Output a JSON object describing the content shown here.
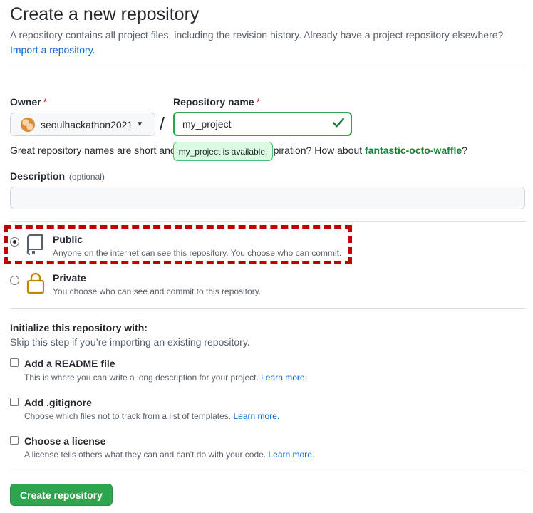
{
  "page": {
    "title": "Create a new repository",
    "intro": "A repository contains all project files, including the revision history. Already have a project repository elsewhere?",
    "import_link": "Import a repository."
  },
  "owner": {
    "label": "Owner",
    "required_mark": "*",
    "value": "seoulhackathon2021"
  },
  "repo_name": {
    "label": "Repository name",
    "required_mark": "*",
    "value": "my_project",
    "availability_tooltip": "my_project is available.",
    "valid_icon": "check-icon"
  },
  "name_hint": {
    "prefix": "Great repository names are short and memorable. Need inspiration? How about ",
    "suggestion": "fantastic-octo-waffle",
    "suffix": "?"
  },
  "description": {
    "label": "Description",
    "optional": "(optional)",
    "value": ""
  },
  "visibility": {
    "selected": "Public",
    "options": [
      {
        "title": "Public",
        "desc": "Anyone on the internet can see this repository. You choose who can commit.",
        "icon": "repo-icon"
      },
      {
        "title": "Private",
        "desc": "You choose who can see and commit to this repository.",
        "icon": "lock-icon"
      }
    ]
  },
  "initialize": {
    "title": "Initialize this repository with:",
    "subtitle": "Skip this step if you’re importing an existing repository.",
    "items": [
      {
        "title": "Add a README file",
        "desc": "This is where you can write a long description for your project.",
        "link": "Learn more.",
        "checked": false
      },
      {
        "title": "Add .gitignore",
        "desc": "Choose which files not to track from a list of templates.",
        "link": "Learn more.",
        "checked": false
      },
      {
        "title": "Choose a license",
        "desc": "A license tells others what they can and can't do with your code.",
        "link": "Learn more.",
        "checked": false
      }
    ]
  },
  "submit": {
    "label": "Create repository"
  },
  "colors": {
    "accent_green": "#2da44e",
    "link_blue": "#0969da",
    "highlight_red": "#c00000"
  }
}
